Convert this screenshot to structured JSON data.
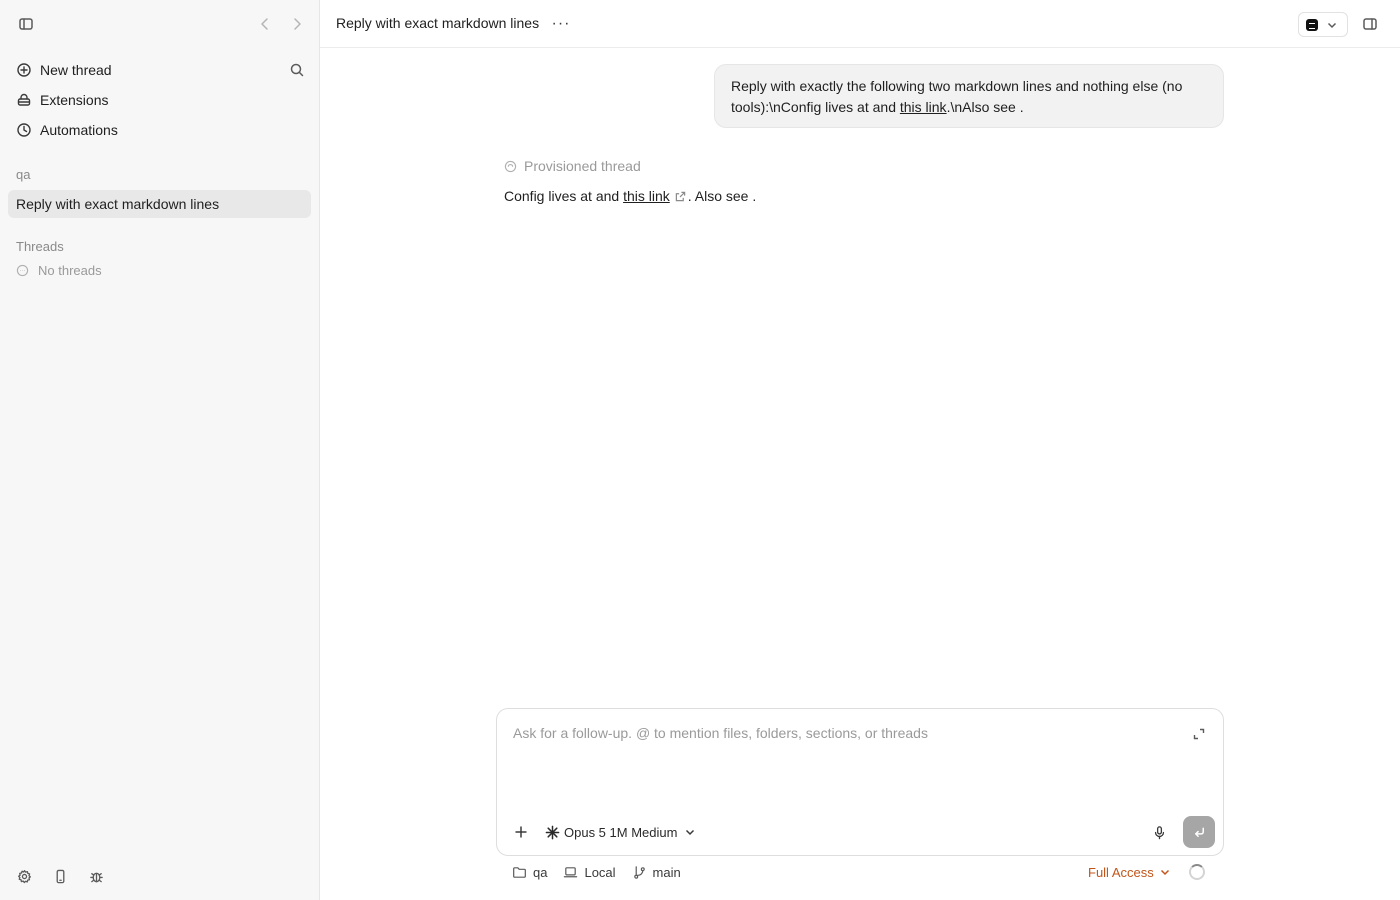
{
  "sidebar": {
    "nav": [
      {
        "label": "New thread",
        "icon": "plus-circle-icon"
      },
      {
        "label": "Extensions",
        "icon": "extensions-icon"
      },
      {
        "label": "Automations",
        "icon": "clock-icon"
      }
    ],
    "project_label": "qa",
    "active_thread": "Reply with exact markdown lines",
    "threads_label": "Threads",
    "empty_threads": "No threads"
  },
  "header": {
    "title": "Reply with exact markdown lines",
    "more_label": "···"
  },
  "conversation": {
    "user_message": {
      "part1": "Reply with exactly the following two markdown lines and nothing else (no tools):\\nConfig lives at and ",
      "link": "this link",
      "part2": ".\\nAlso see ."
    },
    "status": "Provisioned thread",
    "assistant": {
      "part1": "Config lives at and ",
      "link": "this link",
      "part2": ". Also see ."
    }
  },
  "composer": {
    "placeholder": "Ask for a follow-up. @ to mention files, folders, sections, or threads",
    "model": "Opus 5 1M Medium"
  },
  "status_bar": {
    "folder": "qa",
    "environment": "Local",
    "branch": "main",
    "access": "Full Access"
  },
  "colors": {
    "accent": "#c2551a",
    "sidebar_bg": "#f7f7f7",
    "active_item_bg": "#e8e8e8",
    "bubble_bg": "#f2f2f2",
    "send_button": "#a6a6a6"
  }
}
